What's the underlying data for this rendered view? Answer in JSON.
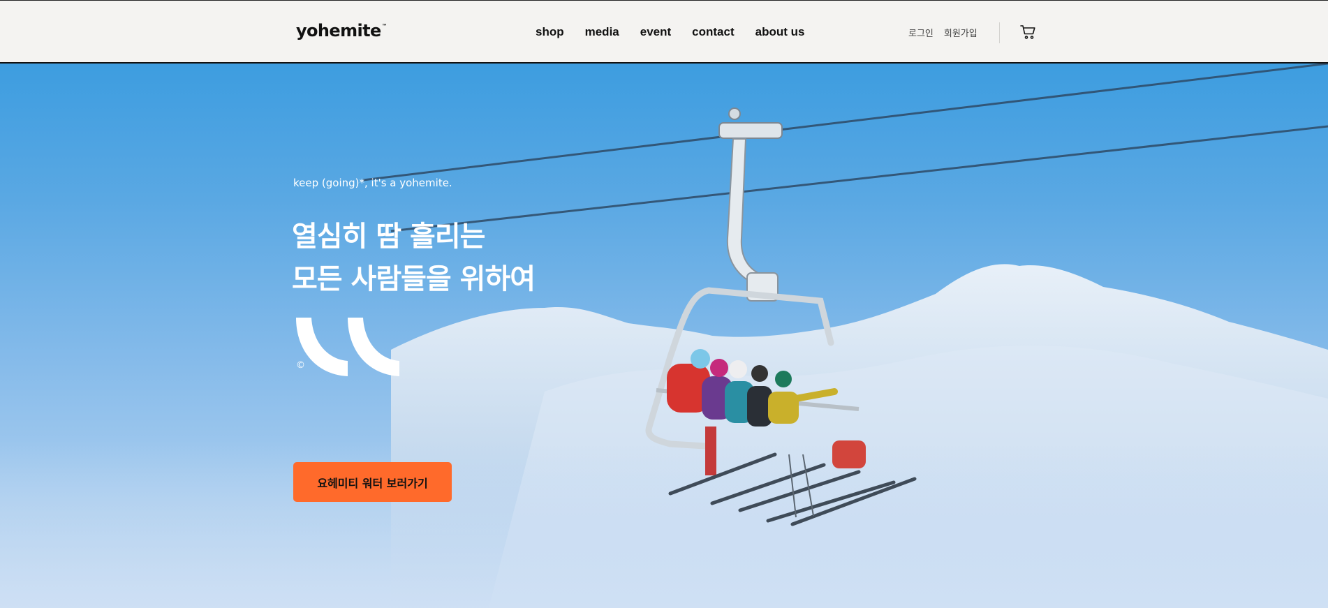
{
  "header": {
    "logo": "yohemite",
    "logo_mark": "™",
    "nav": [
      {
        "label": "shop"
      },
      {
        "label": "media"
      },
      {
        "label": "event"
      },
      {
        "label": "contact"
      },
      {
        "label": "about us"
      }
    ],
    "auth": {
      "login": "로그인",
      "signup": "회원가입"
    },
    "cart_icon": "cart-icon"
  },
  "hero": {
    "tagline": "keep (going)*, it's a yohemite.",
    "headline_line1": "열심히 땀 흘리는",
    "headline_line2": "모든 사람들을 위하여",
    "copyright_symbol": "©",
    "cta_label": "요헤미티 워터 보러가기",
    "image": "chairlift-skiers-photo"
  },
  "colors": {
    "header_bg": "#f4f3f1",
    "accent": "#ff6a2b",
    "sky": "#3d9de0",
    "text_dark": "#111111",
    "text_light": "#ffffff"
  }
}
